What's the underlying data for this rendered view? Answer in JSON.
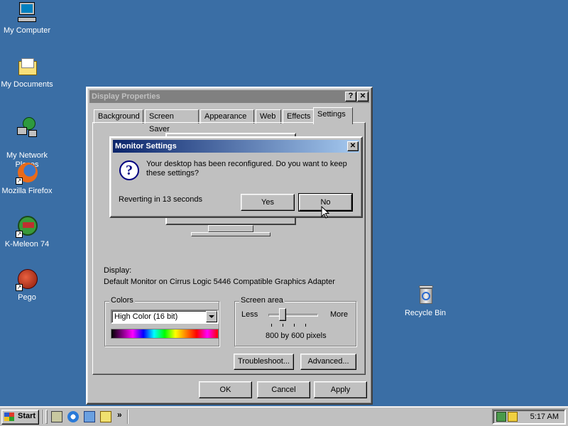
{
  "desktop": {
    "icons": [
      {
        "label": "My Computer",
        "icon": "computer-icon"
      },
      {
        "label": "My Documents",
        "icon": "folder-icon"
      },
      {
        "label": "My Network\nPlaces",
        "icon": "network-icon"
      },
      {
        "label": "Mozilla Firefox",
        "icon": "firefox-icon"
      },
      {
        "label": "K-Meleon 74",
        "icon": "kmeleon-icon"
      },
      {
        "label": "Pego",
        "icon": "pego-icon"
      },
      {
        "label": "Recycle Bin",
        "icon": "recycle-bin-icon"
      }
    ]
  },
  "display_properties": {
    "title": "Display Properties",
    "help_glyph": "?",
    "close_glyph": "✕",
    "tabs": [
      "Background",
      "Screen Saver",
      "Appearance",
      "Web",
      "Effects",
      "Settings"
    ],
    "active_tab": "Settings",
    "display_label": "Display:",
    "display_value": "Default Monitor on Cirrus Logic 5446 Compatible Graphics Adapter",
    "colors": {
      "legend": "Colors",
      "selected": "High Color (16 bit)"
    },
    "screen_area": {
      "legend": "Screen area",
      "less": "Less",
      "more": "More",
      "value": "800 by 600 pixels"
    },
    "troubleshoot": "Troubleshoot...",
    "advanced": "Advanced...",
    "ok": "OK",
    "cancel": "Cancel",
    "apply": "Apply"
  },
  "monitor_dialog": {
    "title": "Monitor Settings",
    "close_glyph": "✕",
    "message": "Your desktop has been reconfigured.  Do you want to keep these settings?",
    "countdown": "Reverting in 13 seconds",
    "yes": "Yes",
    "no": "No"
  },
  "taskbar": {
    "start": "Start",
    "quicklaunch_more": "»",
    "clock": "5:17 AM"
  }
}
